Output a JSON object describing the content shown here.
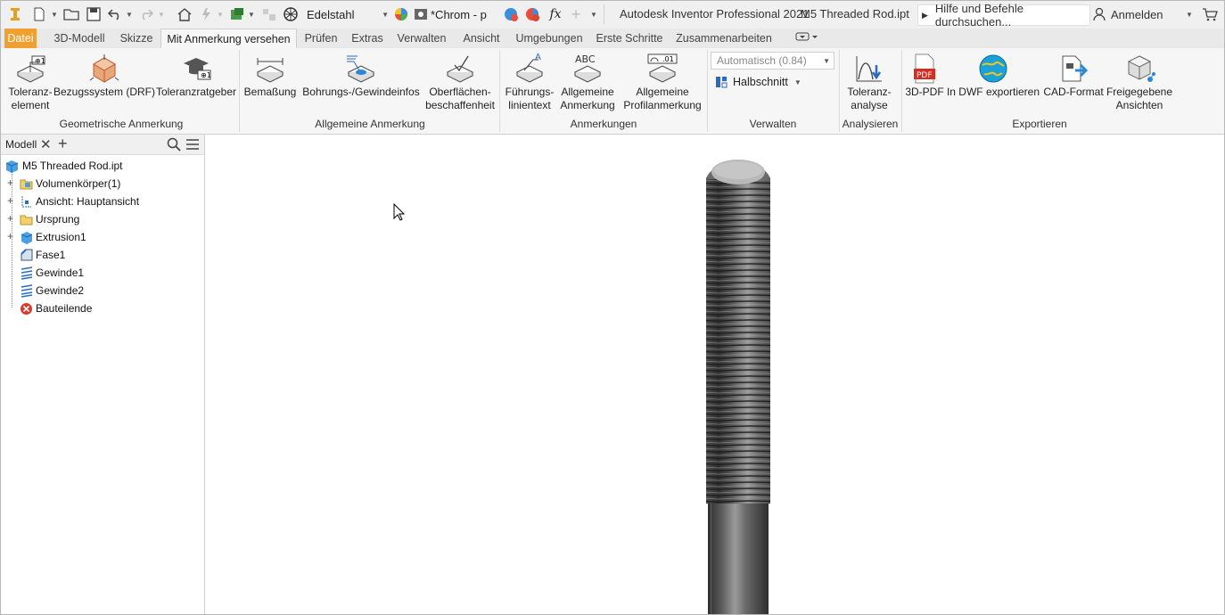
{
  "qat": {
    "app_icon": "inventor-app-icon",
    "material": "Edelstahl",
    "appearance": "*Chrom - p",
    "app_title": "Autodesk Inventor Professional 2021",
    "doc_title": "M5 Threaded Rod.ipt",
    "search_text": "Hilfe und Befehle durchsuchen...",
    "login_label": "Anmelden"
  },
  "tabs": [
    {
      "label": "Datei"
    },
    {
      "label": "3D-Modell"
    },
    {
      "label": "Skizze"
    },
    {
      "label": "Mit Anmerkung versehen"
    },
    {
      "label": "Prüfen"
    },
    {
      "label": "Extras"
    },
    {
      "label": "Verwalten"
    },
    {
      "label": "Ansicht"
    },
    {
      "label": "Umgebungen"
    },
    {
      "label": "Erste Schritte"
    },
    {
      "label": "Zusammenarbeiten"
    }
  ],
  "ribbon": {
    "tools": {
      "toleranzelement": "Toleranz-\nelement",
      "bezugssystem": "Bezugssystem (DRF)",
      "toleranzratgeber": "Toleranzratgeber",
      "bemassung": "Bemaßung",
      "bohrungsinfos": "Bohrungs-/Gewindeinfos",
      "oberflaeche": "Oberflächen-\nbeschaffenheit",
      "fuehrungstext": "Führungs-\nlinientext",
      "allg_anmerkung": "Allgemeine\nAnmerkung",
      "allg_profil": "Allgemeine\nProfilanmerkung",
      "toleranzanalyse": "Toleranz-\nanalyse",
      "pdf3d": "3D-PDF",
      "dwf": "In DWF exportieren",
      "cad": "CAD-Format",
      "freigegeben": "Freigegebene\nAnsichten"
    },
    "combo_value": "Automatisch (0.84)",
    "halbschnitt": "Halbschnitt",
    "pdf_icon_text": "PDF",
    "abc_icon_text": "ABC",
    "profil_icon_text": ".01",
    "panels": {
      "geometrisch": "Geometrische Anmerkung",
      "allgemein": "Allgemeine Anmerkung",
      "anmerkungen": "Anmerkungen",
      "verwalten": "Verwalten",
      "analysieren": "Analysieren",
      "exportieren": "Exportieren"
    }
  },
  "browser": {
    "tab_label": "Modell",
    "items": [
      {
        "label": "M5 Threaded Rod.ipt",
        "icon": "part-icon"
      },
      {
        "label": "Volumenkörper(1)",
        "icon": "folder-icon"
      },
      {
        "label": "Ansicht: Hauptansicht",
        "icon": "view-icon"
      },
      {
        "label": "Ursprung",
        "icon": "folder-icon"
      },
      {
        "label": "Extrusion1",
        "icon": "extrusion-icon"
      },
      {
        "label": "Fase1",
        "icon": "chamfer-icon"
      },
      {
        "label": "Gewinde1",
        "icon": "thread-icon"
      },
      {
        "label": "Gewinde2",
        "icon": "thread-icon"
      },
      {
        "label": "Bauteilende",
        "icon": "end-of-part-icon"
      }
    ]
  },
  "colors": {
    "file_tab": "#f0a030",
    "accent_blue": "#1a73c8",
    "rod_dark": "#3a3a3a",
    "rod_light": "#9a9a9a"
  }
}
